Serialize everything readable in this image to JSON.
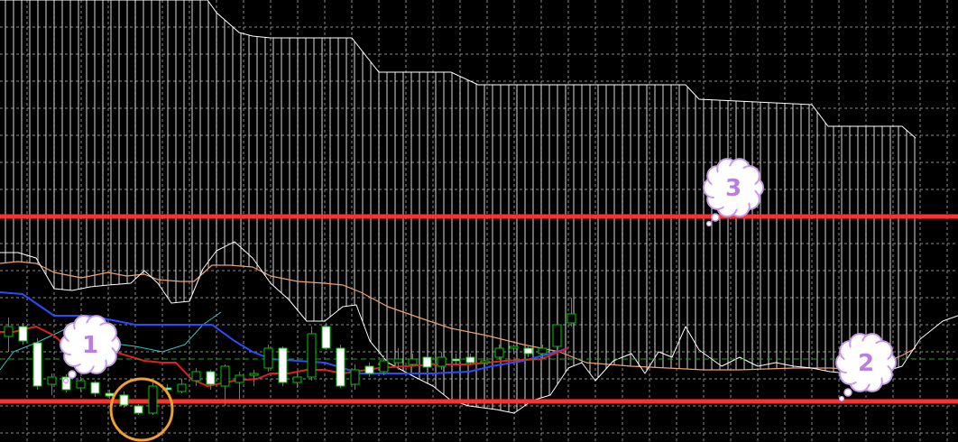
{
  "chart_data": {
    "type": "candlestick",
    "title": "",
    "xlabel": "",
    "ylabel": "",
    "grid": true,
    "ylim": [
      0,
      490
    ],
    "colors": {
      "background": "#000000",
      "grid": "#8a8a8a",
      "bull_candle": "#00c800",
      "bear_candle": "#ffffff",
      "candle_outline": "#00c800",
      "tenkan": "#e02020",
      "kijun": "#2a4cff",
      "chikou": "#3fbfbf",
      "senkou_a": "#f0a070",
      "senkou_b": "#ffffff",
      "kumo_hatch": "#ffffff",
      "horizontal_level": "#ff3030",
      "current_price": "#28a028",
      "bubble_fill": "#ffffff",
      "bubble_stroke": "#c79ae8",
      "bubble_text": "#b87fe0",
      "circle_highlight": "#f0a030"
    },
    "horizontal_levels": [
      {
        "name": "level-3",
        "y": 250
      },
      {
        "name": "level-2",
        "y": 45
      }
    ],
    "current_price": 92,
    "candles": [
      {
        "x": 5,
        "o": 117,
        "h": 138,
        "l": 100,
        "c": 128
      },
      {
        "x": 21,
        "o": 128,
        "h": 132,
        "l": 108,
        "c": 112
      },
      {
        "x": 37,
        "o": 110,
        "h": 115,
        "l": 58,
        "c": 62
      },
      {
        "x": 53,
        "o": 64,
        "h": 76,
        "l": 52,
        "c": 72
      },
      {
        "x": 69,
        "o": 72,
        "h": 75,
        "l": 55,
        "c": 58
      },
      {
        "x": 85,
        "o": 60,
        "h": 72,
        "l": 56,
        "c": 68
      },
      {
        "x": 101,
        "o": 66,
        "h": 68,
        "l": 50,
        "c": 54
      },
      {
        "x": 117,
        "o": 54,
        "h": 58,
        "l": 48,
        "c": 51
      },
      {
        "x": 133,
        "o": 52,
        "h": 56,
        "l": 38,
        "c": 41
      },
      {
        "x": 149,
        "o": 40,
        "h": 42,
        "l": 30,
        "c": 32
      },
      {
        "x": 165,
        "o": 32,
        "h": 66,
        "l": 30,
        "c": 62
      },
      {
        "x": 181,
        "o": 60,
        "h": 64,
        "l": 56,
        "c": 58
      },
      {
        "x": 197,
        "o": 56,
        "h": 70,
        "l": 54,
        "c": 64
      },
      {
        "x": 213,
        "o": 68,
        "h": 82,
        "l": 62,
        "c": 78
      },
      {
        "x": 229,
        "o": 78,
        "h": 80,
        "l": 58,
        "c": 64
      },
      {
        "x": 245,
        "o": 62,
        "h": 86,
        "l": 40,
        "c": 84
      },
      {
        "x": 261,
        "o": 66,
        "h": 78,
        "l": 46,
        "c": 74
      },
      {
        "x": 277,
        "o": 74,
        "h": 80,
        "l": 62,
        "c": 76
      },
      {
        "x": 293,
        "o": 82,
        "h": 108,
        "l": 78,
        "c": 104
      },
      {
        "x": 309,
        "o": 104,
        "h": 106,
        "l": 62,
        "c": 66
      },
      {
        "x": 325,
        "o": 66,
        "h": 78,
        "l": 60,
        "c": 72
      },
      {
        "x": 341,
        "o": 72,
        "h": 128,
        "l": 68,
        "c": 120
      },
      {
        "x": 357,
        "o": 128,
        "h": 132,
        "l": 102,
        "c": 104
      },
      {
        "x": 373,
        "o": 104,
        "h": 108,
        "l": 60,
        "c": 62
      },
      {
        "x": 389,
        "o": 64,
        "h": 86,
        "l": 58,
        "c": 80
      },
      {
        "x": 405,
        "o": 84,
        "h": 88,
        "l": 72,
        "c": 76
      },
      {
        "x": 421,
        "o": 78,
        "h": 96,
        "l": 74,
        "c": 90
      },
      {
        "x": 437,
        "o": 88,
        "h": 104,
        "l": 80,
        "c": 92
      },
      {
        "x": 453,
        "o": 86,
        "h": 98,
        "l": 84,
        "c": 92
      },
      {
        "x": 469,
        "o": 94,
        "h": 96,
        "l": 80,
        "c": 83
      },
      {
        "x": 485,
        "o": 84,
        "h": 100,
        "l": 80,
        "c": 94
      },
      {
        "x": 501,
        "o": 92,
        "h": 98,
        "l": 86,
        "c": 90
      },
      {
        "x": 517,
        "o": 94,
        "h": 98,
        "l": 86,
        "c": 88
      },
      {
        "x": 533,
        "o": 88,
        "h": 94,
        "l": 82,
        "c": 90
      },
      {
        "x": 549,
        "o": 94,
        "h": 108,
        "l": 92,
        "c": 104
      },
      {
        "x": 565,
        "o": 104,
        "h": 108,
        "l": 98,
        "c": 106
      },
      {
        "x": 581,
        "o": 104,
        "h": 106,
        "l": 94,
        "c": 98
      },
      {
        "x": 597,
        "o": 98,
        "h": 108,
        "l": 92,
        "c": 104
      },
      {
        "x": 613,
        "o": 106,
        "h": 150,
        "l": 100,
        "c": 130
      },
      {
        "x": 629,
        "o": 132,
        "h": 160,
        "l": 128,
        "c": 142
      }
    ],
    "tenkan": [
      [
        0,
        122
      ],
      [
        15,
        122
      ],
      [
        40,
        128
      ],
      [
        60,
        118
      ],
      [
        80,
        100
      ],
      [
        100,
        98
      ],
      [
        120,
        102
      ],
      [
        140,
        96
      ],
      [
        160,
        90
      ],
      [
        180,
        88
      ],
      [
        195,
        88
      ],
      [
        212,
        70
      ],
      [
        230,
        62
      ],
      [
        260,
        68
      ],
      [
        285,
        70
      ],
      [
        300,
        76
      ],
      [
        320,
        76
      ],
      [
        340,
        80
      ],
      [
        360,
        80
      ],
      [
        380,
        76
      ],
      [
        420,
        82
      ],
      [
        480,
        86
      ],
      [
        520,
        86
      ],
      [
        560,
        90
      ],
      [
        600,
        92
      ],
      [
        630,
        104
      ]
    ],
    "kijun": [
      [
        0,
        166
      ],
      [
        25,
        164
      ],
      [
        60,
        140
      ],
      [
        100,
        140
      ],
      [
        140,
        132
      ],
      [
        150,
        130
      ],
      [
        235,
        130
      ],
      [
        260,
        112
      ],
      [
        280,
        100
      ],
      [
        300,
        92
      ],
      [
        330,
        90
      ],
      [
        360,
        88
      ],
      [
        400,
        76
      ],
      [
        440,
        76
      ],
      [
        480,
        76
      ],
      [
        520,
        78
      ],
      [
        545,
        84
      ],
      [
        580,
        90
      ],
      [
        610,
        98
      ],
      [
        630,
        104
      ]
    ],
    "chikou": [
      [
        0,
        80
      ],
      [
        15,
        100
      ],
      [
        40,
        110
      ],
      [
        70,
        124
      ],
      [
        100,
        130
      ],
      [
        120,
        110
      ],
      [
        150,
        106
      ],
      [
        180,
        100
      ],
      [
        205,
        108
      ],
      [
        225,
        130
      ],
      [
        245,
        144
      ]
    ],
    "senkou_a": [
      [
        0,
        198
      ],
      [
        20,
        200
      ],
      [
        40,
        198
      ],
      [
        60,
        188
      ],
      [
        90,
        182
      ],
      [
        120,
        188
      ],
      [
        140,
        184
      ],
      [
        160,
        186
      ],
      [
        175,
        180
      ],
      [
        200,
        178
      ],
      [
        215,
        178
      ],
      [
        235,
        196
      ],
      [
        255,
        196
      ],
      [
        280,
        194
      ],
      [
        300,
        184
      ],
      [
        330,
        178
      ],
      [
        360,
        176
      ],
      [
        380,
        174
      ],
      [
        400,
        166
      ],
      [
        430,
        150
      ],
      [
        470,
        136
      ],
      [
        500,
        126
      ],
      [
        540,
        118
      ],
      [
        580,
        108
      ],
      [
        620,
        100
      ],
      [
        650,
        88
      ],
      [
        700,
        84
      ],
      [
        740,
        82
      ],
      [
        780,
        80
      ],
      [
        820,
        80
      ],
      [
        880,
        82
      ],
      [
        920,
        82
      ],
      [
        960,
        80
      ],
      [
        1000,
        96
      ],
      [
        1015,
        104
      ]
    ],
    "senkou_b": [
      [
        0,
        210
      ],
      [
        20,
        210
      ],
      [
        40,
        204
      ],
      [
        60,
        170
      ],
      [
        80,
        168
      ],
      [
        100,
        172
      ],
      [
        120,
        174
      ],
      [
        145,
        176
      ],
      [
        160,
        190
      ],
      [
        175,
        176
      ],
      [
        190,
        154
      ],
      [
        210,
        156
      ],
      [
        225,
        192
      ],
      [
        240,
        212
      ],
      [
        260,
        222
      ],
      [
        280,
        204
      ],
      [
        300,
        176
      ],
      [
        320,
        158
      ],
      [
        340,
        134
      ],
      [
        360,
        134
      ],
      [
        380,
        150
      ],
      [
        395,
        152
      ],
      [
        410,
        112
      ],
      [
        430,
        88
      ],
      [
        460,
        72
      ],
      [
        480,
        62
      ],
      [
        500,
        46
      ],
      [
        520,
        40
      ],
      [
        550,
        36
      ],
      [
        570,
        32
      ],
      [
        590,
        46
      ],
      [
        610,
        52
      ],
      [
        630,
        82
      ],
      [
        645,
        88
      ],
      [
        660,
        68
      ],
      [
        680,
        90
      ],
      [
        700,
        98
      ],
      [
        715,
        76
      ],
      [
        730,
        100
      ],
      [
        745,
        94
      ],
      [
        760,
        128
      ],
      [
        775,
        102
      ],
      [
        800,
        84
      ],
      [
        820,
        94
      ],
      [
        840,
        84
      ],
      [
        860,
        88
      ],
      [
        880,
        84
      ],
      [
        900,
        82
      ],
      [
        920,
        78
      ],
      [
        940,
        76
      ],
      [
        960,
        74
      ],
      [
        980,
        78
      ],
      [
        1000,
        84
      ],
      [
        1020,
        114
      ],
      [
        1045,
        134
      ],
      [
        1062,
        140
      ]
    ],
    "kumo_top": [
      [
        0,
        490
      ],
      [
        230,
        490
      ],
      [
        240,
        476
      ],
      [
        265,
        454
      ],
      [
        280,
        450
      ],
      [
        300,
        448
      ],
      [
        390,
        448
      ],
      [
        420,
        410
      ],
      [
        500,
        410
      ],
      [
        530,
        396
      ],
      [
        760,
        396
      ],
      [
        775,
        380
      ],
      [
        900,
        374
      ],
      [
        918,
        350
      ],
      [
        1000,
        350
      ],
      [
        1015,
        337
      ]
    ],
    "bubbles": [
      {
        "label": "1",
        "x": 100,
        "y": 108
      },
      {
        "label": "2",
        "x": 960,
        "y": 88
      },
      {
        "label": "3",
        "x": 813,
        "y": 282
      }
    ],
    "highlight_circle": {
      "x": 157,
      "y": 36,
      "r": 34
    }
  }
}
